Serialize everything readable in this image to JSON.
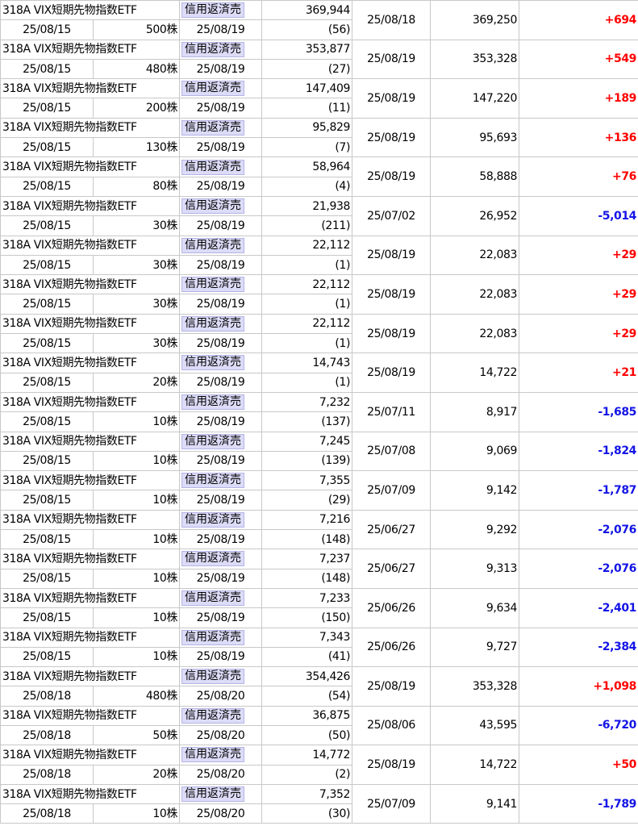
{
  "colors": {
    "positive": "#ff0000",
    "negative": "#1414e6",
    "type_tag_bg": "#dcdcf8"
  },
  "rows": [
    {
      "name": "318A VIX短期先物指数ETF",
      "buy_date": "25/08/15",
      "qty": "500株",
      "type": "信用返済売",
      "settle_date": "25/08/19",
      "cost": "369,944",
      "days": "(56)",
      "open_date": "25/08/18",
      "price": "369,250",
      "pl": "+694",
      "sign": "pos"
    },
    {
      "name": "318A VIX短期先物指数ETF",
      "buy_date": "25/08/15",
      "qty": "480株",
      "type": "信用返済売",
      "settle_date": "25/08/19",
      "cost": "353,877",
      "days": "(27)",
      "open_date": "25/08/19",
      "price": "353,328",
      "pl": "+549",
      "sign": "pos"
    },
    {
      "name": "318A VIX短期先物指数ETF",
      "buy_date": "25/08/15",
      "qty": "200株",
      "type": "信用返済売",
      "settle_date": "25/08/19",
      "cost": "147,409",
      "days": "(11)",
      "open_date": "25/08/19",
      "price": "147,220",
      "pl": "+189",
      "sign": "pos"
    },
    {
      "name": "318A VIX短期先物指数ETF",
      "buy_date": "25/08/15",
      "qty": "130株",
      "type": "信用返済売",
      "settle_date": "25/08/19",
      "cost": "95,829",
      "days": "(7)",
      "open_date": "25/08/19",
      "price": "95,693",
      "pl": "+136",
      "sign": "pos"
    },
    {
      "name": "318A VIX短期先物指数ETF",
      "buy_date": "25/08/15",
      "qty": "80株",
      "type": "信用返済売",
      "settle_date": "25/08/19",
      "cost": "58,964",
      "days": "(4)",
      "open_date": "25/08/19",
      "price": "58,888",
      "pl": "+76",
      "sign": "pos"
    },
    {
      "name": "318A VIX短期先物指数ETF",
      "buy_date": "25/08/15",
      "qty": "30株",
      "type": "信用返済売",
      "settle_date": "25/08/19",
      "cost": "21,938",
      "days": "(211)",
      "open_date": "25/07/02",
      "price": "26,952",
      "pl": "-5,014",
      "sign": "neg"
    },
    {
      "name": "318A VIX短期先物指数ETF",
      "buy_date": "25/08/15",
      "qty": "30株",
      "type": "信用返済売",
      "settle_date": "25/08/19",
      "cost": "22,112",
      "days": "(1)",
      "open_date": "25/08/19",
      "price": "22,083",
      "pl": "+29",
      "sign": "pos"
    },
    {
      "name": "318A VIX短期先物指数ETF",
      "buy_date": "25/08/15",
      "qty": "30株",
      "type": "信用返済売",
      "settle_date": "25/08/19",
      "cost": "22,112",
      "days": "(1)",
      "open_date": "25/08/19",
      "price": "22,083",
      "pl": "+29",
      "sign": "pos"
    },
    {
      "name": "318A VIX短期先物指数ETF",
      "buy_date": "25/08/15",
      "qty": "30株",
      "type": "信用返済売",
      "settle_date": "25/08/19",
      "cost": "22,112",
      "days": "(1)",
      "open_date": "25/08/19",
      "price": "22,083",
      "pl": "+29",
      "sign": "pos"
    },
    {
      "name": "318A VIX短期先物指数ETF",
      "buy_date": "25/08/15",
      "qty": "20株",
      "type": "信用返済売",
      "settle_date": "25/08/19",
      "cost": "14,743",
      "days": "(1)",
      "open_date": "25/08/19",
      "price": "14,722",
      "pl": "+21",
      "sign": "pos"
    },
    {
      "name": "318A VIX短期先物指数ETF",
      "buy_date": "25/08/15",
      "qty": "10株",
      "type": "信用返済売",
      "settle_date": "25/08/19",
      "cost": "7,232",
      "days": "(137)",
      "open_date": "25/07/11",
      "price": "8,917",
      "pl": "-1,685",
      "sign": "neg"
    },
    {
      "name": "318A VIX短期先物指数ETF",
      "buy_date": "25/08/15",
      "qty": "10株",
      "type": "信用返済売",
      "settle_date": "25/08/19",
      "cost": "7,245",
      "days": "(139)",
      "open_date": "25/07/08",
      "price": "9,069",
      "pl": "-1,824",
      "sign": "neg"
    },
    {
      "name": "318A VIX短期先物指数ETF",
      "buy_date": "25/08/15",
      "qty": "10株",
      "type": "信用返済売",
      "settle_date": "25/08/19",
      "cost": "7,355",
      "days": "(29)",
      "open_date": "25/07/09",
      "price": "9,142",
      "pl": "-1,787",
      "sign": "neg"
    },
    {
      "name": "318A VIX短期先物指数ETF",
      "buy_date": "25/08/15",
      "qty": "10株",
      "type": "信用返済売",
      "settle_date": "25/08/19",
      "cost": "7,216",
      "days": "(148)",
      "open_date": "25/06/27",
      "price": "9,292",
      "pl": "-2,076",
      "sign": "neg"
    },
    {
      "name": "318A VIX短期先物指数ETF",
      "buy_date": "25/08/15",
      "qty": "10株",
      "type": "信用返済売",
      "settle_date": "25/08/19",
      "cost": "7,237",
      "days": "(148)",
      "open_date": "25/06/27",
      "price": "9,313",
      "pl": "-2,076",
      "sign": "neg"
    },
    {
      "name": "318A VIX短期先物指数ETF",
      "buy_date": "25/08/15",
      "qty": "10株",
      "type": "信用返済売",
      "settle_date": "25/08/19",
      "cost": "7,233",
      "days": "(150)",
      "open_date": "25/06/26",
      "price": "9,634",
      "pl": "-2,401",
      "sign": "neg"
    },
    {
      "name": "318A VIX短期先物指数ETF",
      "buy_date": "25/08/15",
      "qty": "10株",
      "type": "信用返済売",
      "settle_date": "25/08/19",
      "cost": "7,343",
      "days": "(41)",
      "open_date": "25/06/26",
      "price": "9,727",
      "pl": "-2,384",
      "sign": "neg"
    },
    {
      "name": "318A VIX短期先物指数ETF",
      "buy_date": "25/08/18",
      "qty": "480株",
      "type": "信用返済売",
      "settle_date": "25/08/20",
      "cost": "354,426",
      "days": "(54)",
      "open_date": "25/08/19",
      "price": "353,328",
      "pl": "+1,098",
      "sign": "pos"
    },
    {
      "name": "318A VIX短期先物指数ETF",
      "buy_date": "25/08/18",
      "qty": "50株",
      "type": "信用返済売",
      "settle_date": "25/08/20",
      "cost": "36,875",
      "days": "(50)",
      "open_date": "25/08/06",
      "price": "43,595",
      "pl": "-6,720",
      "sign": "neg"
    },
    {
      "name": "318A VIX短期先物指数ETF",
      "buy_date": "25/08/18",
      "qty": "20株",
      "type": "信用返済売",
      "settle_date": "25/08/20",
      "cost": "14,772",
      "days": "(2)",
      "open_date": "25/08/19",
      "price": "14,722",
      "pl": "+50",
      "sign": "pos"
    },
    {
      "name": "318A VIX短期先物指数ETF",
      "buy_date": "25/08/18",
      "qty": "10株",
      "type": "信用返済売",
      "settle_date": "25/08/20",
      "cost": "7,352",
      "days": "(30)",
      "open_date": "25/07/09",
      "price": "9,141",
      "pl": "-1,789",
      "sign": "neg"
    }
  ]
}
